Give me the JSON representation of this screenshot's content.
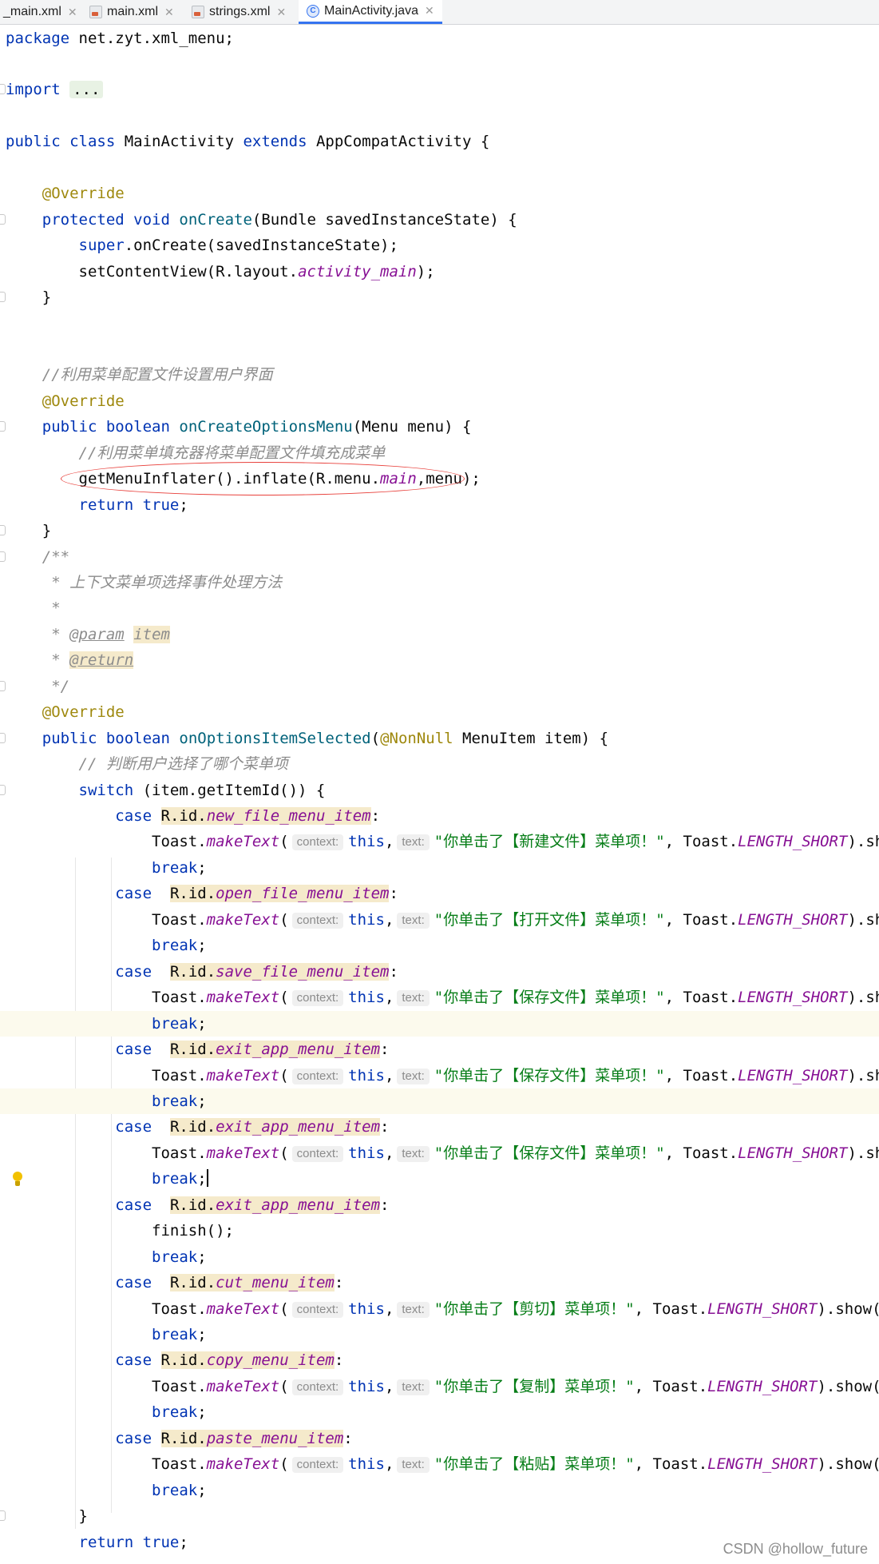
{
  "tabs": [
    {
      "label": "_main.xml",
      "type": "xml"
    },
    {
      "label": "main.xml",
      "type": "xml"
    },
    {
      "label": "strings.xml",
      "type": "xml"
    },
    {
      "label": "MainActivity.java",
      "type": "java",
      "active": true
    }
  ],
  "icons": {
    "java_file": "java-class-icon",
    "xml_file": "xml-file-icon",
    "close": "close-icon",
    "bulb": "lightbulb-icon"
  },
  "colors": {
    "keyword": "#0033b3",
    "annotation": "#9e880d",
    "method": "#00627a",
    "static_field": "#871094",
    "string": "#067d17",
    "comment": "#8c8c8c",
    "highlight_oval": "#e8413c",
    "active_tab": "#3574f0"
  },
  "code": {
    "package_kw": "package",
    "package_name": " net.zyt.xml_menu;",
    "import_kw": "import",
    "import_fold": "...",
    "class_public": "public",
    "class_kw": "class",
    "class_name": " MainActivity ",
    "extends_kw": "extends",
    "class_rest": " AppCompatActivity {",
    "override": "@Override",
    "protected_kw": "protected",
    "void_kw": "void",
    "oncreate": "onCreate",
    "oncreate_params": "(Bundle savedInstanceState) {",
    "super_kw": "super",
    "super_rest": ".onCreate(savedInstanceState);",
    "setcontent": "setContentView(R.layout.",
    "activity_main": "activity_main",
    "setcontent_end": ");",
    "close_brace": "}",
    "comment1": "//利用菜单配置文件设置用户界面",
    "public_kw": "public",
    "boolean_kw": "boolean",
    "oncreateoptions": "onCreateOptionsMenu",
    "oncreateoptions_params": "(Menu menu) {",
    "comment2": "//利用菜单填充器将菜单配置文件填充成菜单",
    "inflate_start": "getMenuInflater().inflate(R.menu.",
    "menu_main": "main",
    "inflate_end": ",menu);",
    "return_kw": "return",
    "true_kw": "true",
    "semicolon": ";",
    "javadoc_open": "/**",
    "javadoc_desc": " * 上下文菜单项选择事件处理方法",
    "javadoc_star": " *",
    "javadoc_star_prefix": " * ",
    "param_tag": "@param",
    "param_name": "item",
    "return_tag": "@return",
    "javadoc_close": " */",
    "onoptions": "onOptionsItemSelected",
    "paren_open": "(",
    "nonnull": "@NonNull",
    "menuitem_param": " MenuItem item) {",
    "comment3": "// 判断用户选择了哪个菜单项",
    "switch_kw": "switch",
    "switch_rest": " (item.getItemId()) {",
    "case_kw": "case",
    "rid": "R.id.",
    "colon": ":",
    "toast_start": "Toast.",
    "maketext": "makeText",
    "hint_context": "context:",
    "this_kw": "this",
    "hint_text": "text:",
    "toast_mid": ", Toast.",
    "length_short": "LENGTH_SHORT",
    "show_end": ").show();",
    "break_kw": "break",
    "finish": "finish();",
    "comma": ","
  },
  "cases": [
    {
      "item": "new_file_menu_item",
      "message": "\"你单击了【新建文件】菜单项！\""
    },
    {
      "item": "open_file_menu_item",
      "message": "\"你单击了【打开文件】菜单项！\""
    },
    {
      "item": "save_file_menu_item",
      "message": "\"你单击了【保存文件】菜单项！\""
    },
    {
      "item": "exit_app_menu_item",
      "message": "\"你单击了【保存文件】菜单项！\""
    },
    {
      "item": "exit_app_menu_item",
      "message": "\"你单击了【保存文件】菜单项！\""
    },
    {
      "item": "exit_app_menu_item"
    },
    {
      "item": "cut_menu_item",
      "message": "\"你单击了【剪切】菜单项！\""
    },
    {
      "item": "copy_menu_item",
      "message": "\"你单击了【复制】菜单项！\""
    },
    {
      "item": "paste_menu_item",
      "message": "\"你单击了【粘贴】菜单项！\""
    }
  ],
  "watermark": "CSDN @hollow_future"
}
